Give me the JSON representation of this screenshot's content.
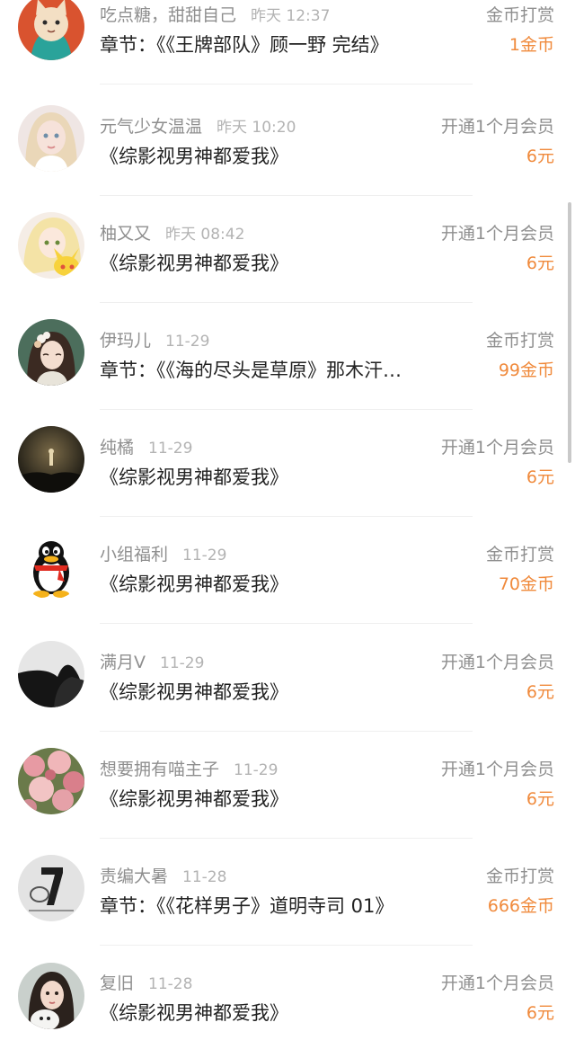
{
  "colors": {
    "name": "#8f8f8f",
    "time": "#b3b3b3",
    "title": "#222222",
    "type": "#8f8f8f",
    "amount": "#f08a3c",
    "divider": "#efefef"
  },
  "records": [
    {
      "name": "吃点糖，甜甜自己",
      "time": "昨天 12:37",
      "title": "章节：《《王牌部队》顾一野 完结》",
      "type": "金币打赏",
      "amount": "1金币",
      "avatar": "cat-avatar-icon"
    },
    {
      "name": "元气少女温温",
      "time": "昨天 10:20",
      "title": "《综影视男神都爱我》",
      "type": "开通1个月会员",
      "amount": "6元",
      "avatar": "doll-girl-avatar-icon"
    },
    {
      "name": "柚又又",
      "time": "昨天 08:42",
      "title": "《综影视男神都爱我》",
      "type": "开通1个月会员",
      "amount": "6元",
      "avatar": "anime-pikachu-avatar-icon"
    },
    {
      "name": "伊玛儿",
      "time": "11-29",
      "title": "章节：《《海的尽头是草原》那木汗…",
      "type": "金币打赏",
      "amount": "99金币",
      "avatar": "flower-girl-avatar-icon"
    },
    {
      "name": "纯橘",
      "time": "11-29",
      "title": "《综影视男神都爱我》",
      "type": "开通1个月会员",
      "amount": "6元",
      "avatar": "dark-forest-avatar-icon"
    },
    {
      "name": "小组福利",
      "time": "11-29",
      "title": "《综影视男神都爱我》",
      "type": "金币打赏",
      "amount": "70金币",
      "avatar": "qq-penguin-avatar-icon"
    },
    {
      "name": "满月V",
      "time": "11-29",
      "title": "《综影视男神都爱我》",
      "type": "开通1个月会员",
      "amount": "6元",
      "avatar": "silhouette-avatar-icon"
    },
    {
      "name": "想要拥有喵主子",
      "time": "11-29",
      "title": "《综影视男神都爱我》",
      "type": "开通1个月会员",
      "amount": "6元",
      "avatar": "roses-avatar-icon"
    },
    {
      "name": "责编大暑",
      "time": "11-28",
      "title": "章节：《《花样男子》道明寺司 01》",
      "type": "金币打赏",
      "amount": "666金币",
      "avatar": "number-seven-avatar-icon"
    },
    {
      "name": "复旧",
      "time": "11-28",
      "title": "《综影视男神都爱我》",
      "type": "开通1个月会员",
      "amount": "6元",
      "avatar": "girl-dog-avatar-icon"
    }
  ]
}
